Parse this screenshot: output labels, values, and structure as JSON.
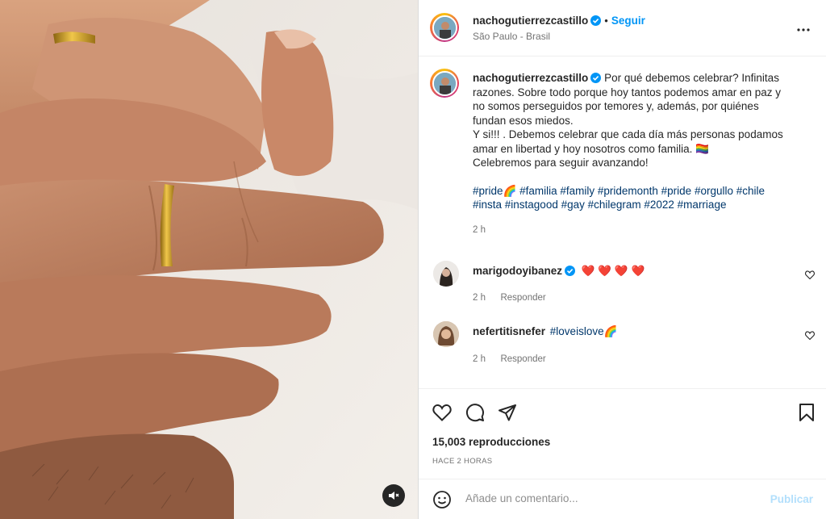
{
  "post": {
    "username": "nachogutierrezcastillo",
    "follow_label": "Seguir",
    "separator": "•",
    "location": "São Paulo - Brasil",
    "more_icon": "more-horizontal-icon",
    "verified_icon": "verified-badge-icon",
    "mute_icon": "speaker-muted-icon"
  },
  "caption": {
    "username": "nachogutierrezcastillo",
    "lines": [
      "Por qué debemos celebrar? Infinitas",
      "razones. Sobre todo porque hoy tantos podemos amar en paz y",
      "no somos perseguidos por temores y, además, por quiénes",
      "fundan esos miedos.",
      "Y si!!! . Debemos celebrar que cada día más personas podamos",
      "amar en libertad y hoy nosotros como familia. 🏳️‍🌈",
      "Celebremos para seguir avanzando!"
    ],
    "hashtags_line1": "#pride🌈 #familia #family #pridemonth #pride #orgullo #chile",
    "hashtags_line2": "#insta #instagood #gay #chilegram #2022 #marriage",
    "time": "2 h"
  },
  "comments": [
    {
      "username": "marigodoyibanez",
      "text": "❤️ ❤️ ❤️ ❤️",
      "time": "2 h",
      "reply": "Responder"
    },
    {
      "username": "nefertitisnefer",
      "text": "#loveislove🌈",
      "time": "2 h",
      "reply": "Responder"
    }
  ],
  "actions": {
    "like_icon": "heart-icon",
    "comment_icon": "comment-bubble-icon",
    "share_icon": "paper-plane-icon",
    "save_icon": "bookmark-icon",
    "views": "15,003 reproducciones",
    "time_ago": "HACE 2 HORAS"
  },
  "comment_box": {
    "emoji_icon": "emoji-smiley-icon",
    "placeholder": "Añade un comentario...",
    "publish_label": "Publicar"
  },
  "colors": {
    "link_blue": "#0095f6",
    "hashtag": "#00376b",
    "heart_red": "#ed4956",
    "publish_disabled": "#b2dffc"
  }
}
